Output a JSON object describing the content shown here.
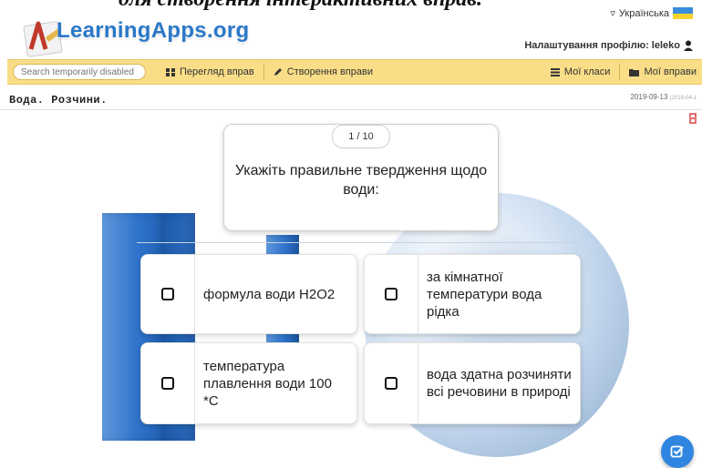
{
  "header": {
    "caption": "для створення інтерактивних вправ.",
    "brand": "LearningApps.org",
    "language": "Українська",
    "language_arrow": "▿",
    "profile_label": "Налаштування профілю: leleko"
  },
  "nav": {
    "search_placeholder": "Search temporarily disabled",
    "browse": "Перегляд вправ",
    "create": "Створення вправи",
    "classes": "Мої класи",
    "my_apps": "Мої вправи"
  },
  "page": {
    "title": "Вода. Розчини.",
    "date": "2019-09-13",
    "date_extra": "(2019-04-1"
  },
  "quiz": {
    "counter": "1 / 10",
    "question": "Укажіть правильне твердження щодо води:",
    "answers": [
      "формула води H2O2",
      "за кімнатної температури вода рідка",
      "температура плавлення води 100 *С",
      "вода здатна розчиняти всі речовини в природі"
    ]
  },
  "colors": {
    "navbar": "#f9dd87",
    "brand": "#2a78c8",
    "accent": "#2f86e0"
  },
  "icons": [
    "grid-icon",
    "pencil-icon",
    "list-icon",
    "folder-icon",
    "user-icon",
    "check-icon"
  ]
}
